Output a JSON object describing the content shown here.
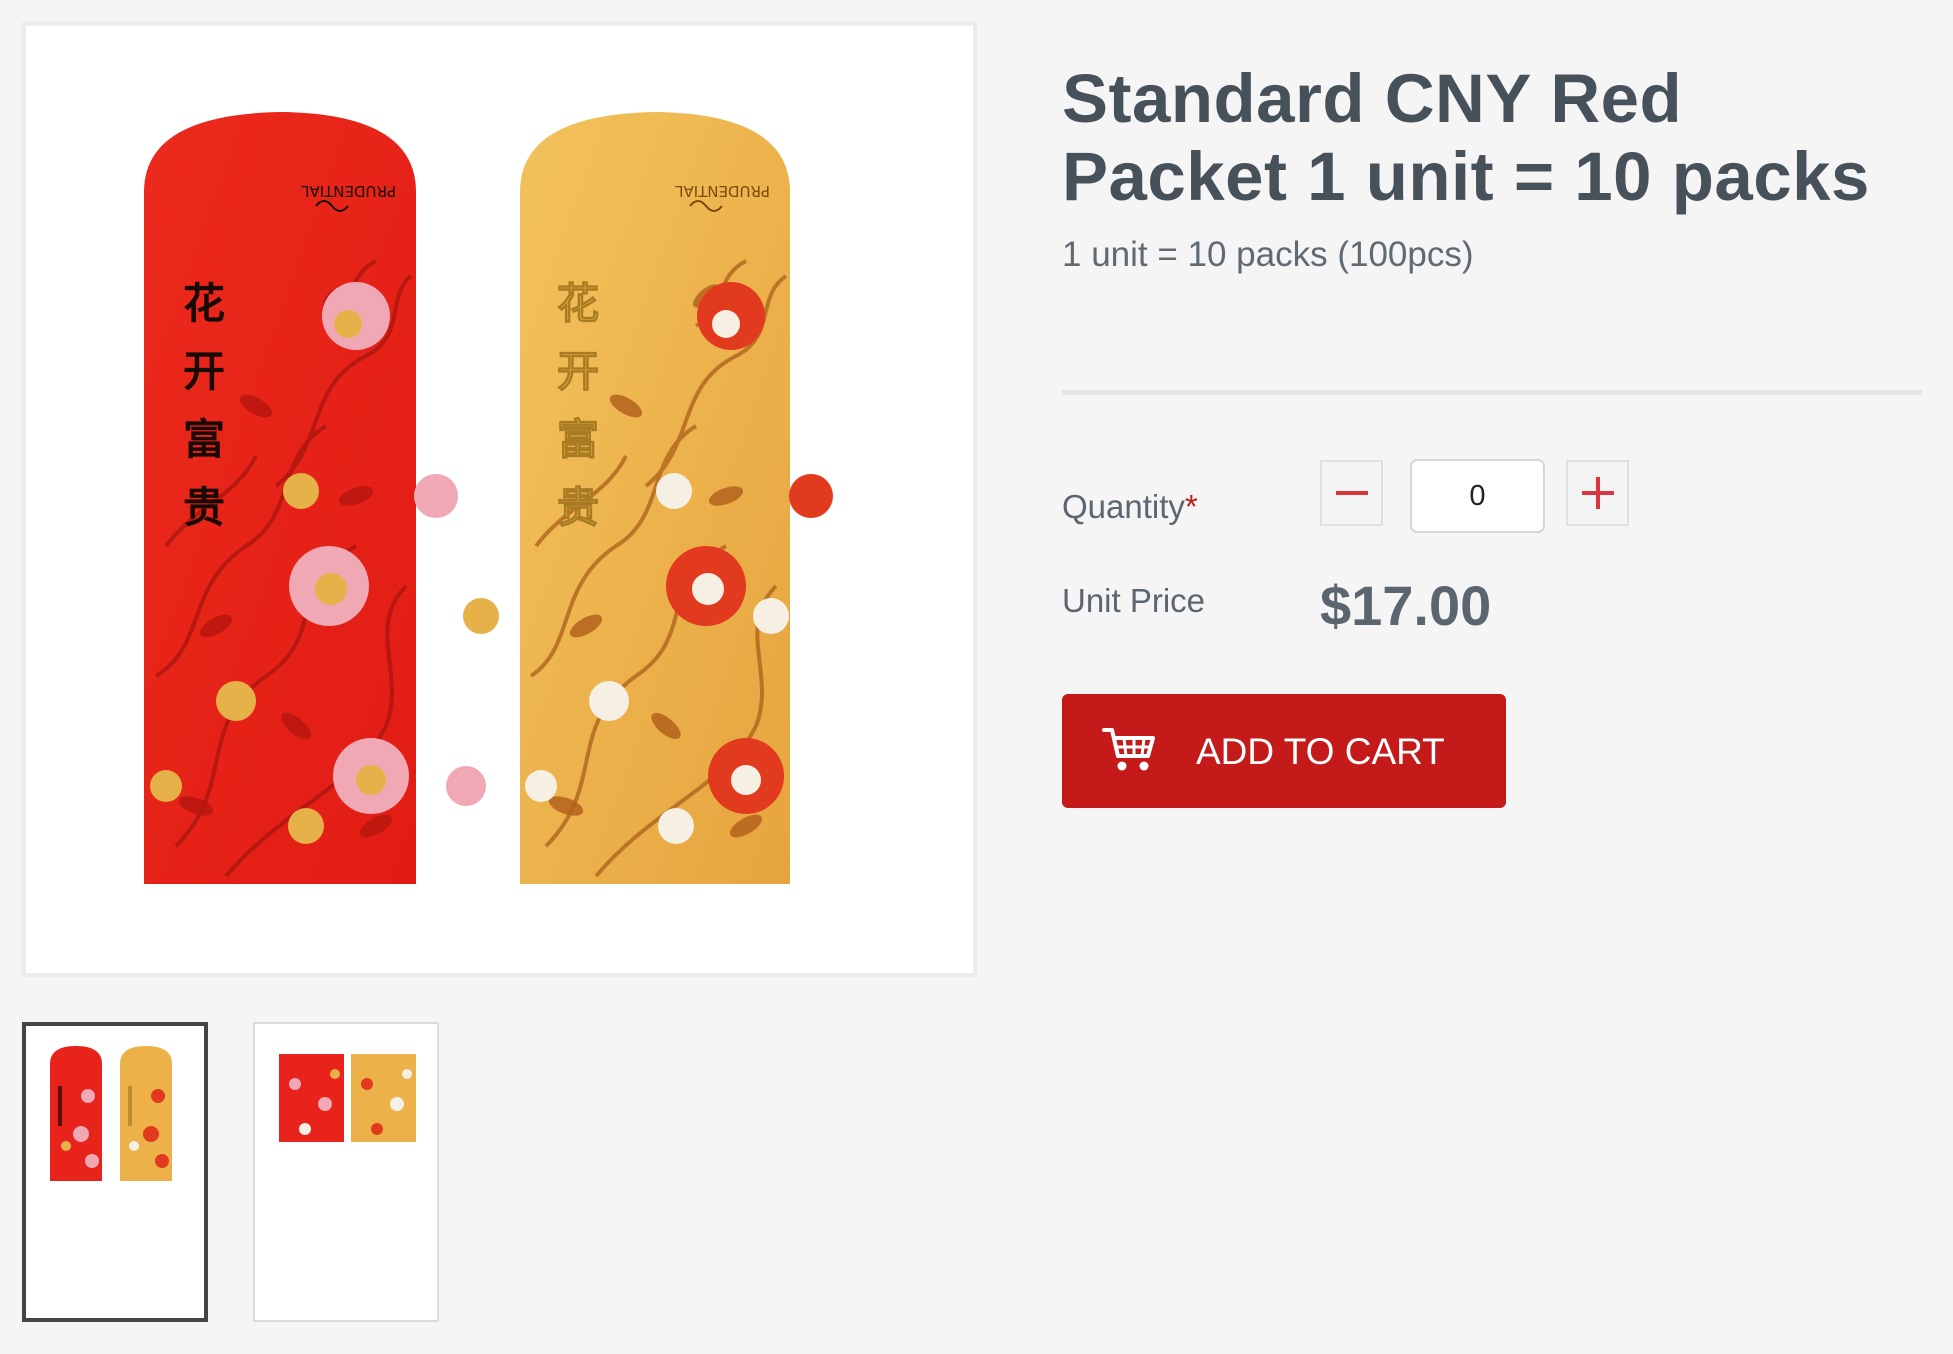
{
  "product": {
    "title": "Standard CNY Red Packet 1 unit = 10 packs",
    "subtitle": "1 unit = 10 packs (100pcs)",
    "image_alt": "Two Chinese New Year red packets, one red and one gold, with floral pattern",
    "packet_text_chars": [
      "花",
      "开",
      "富",
      "贵"
    ],
    "packet_brand_logo": "PRUDENTIAL",
    "colors": {
      "red_packet": "#e8231c",
      "gold_packet": "#ecb149",
      "flower_pink": "#f0a8b4",
      "flower_gold": "#e6b148",
      "flower_white": "#f6efe3",
      "flower_red": "#e23a1e",
      "gold_foil": "#d7a63a"
    }
  },
  "gallery": {
    "thumbnails": [
      {
        "label": "thumbnail-1",
        "selected": true
      },
      {
        "label": "thumbnail-2",
        "selected": false
      }
    ]
  },
  "form": {
    "quantity_label": "Quantity",
    "required_marker": "*",
    "quantity_value": "0",
    "decrement_icon": "minus-icon",
    "increment_icon": "plus-icon",
    "unit_price_label": "Unit Price",
    "unit_price_value": "$17.00"
  },
  "cart": {
    "button_label": "ADD TO CART",
    "icon": "shopping-cart-icon"
  },
  "theme": {
    "accent": "#c41a1a",
    "text_dark": "#47515a",
    "background": "#f5f5f5"
  }
}
